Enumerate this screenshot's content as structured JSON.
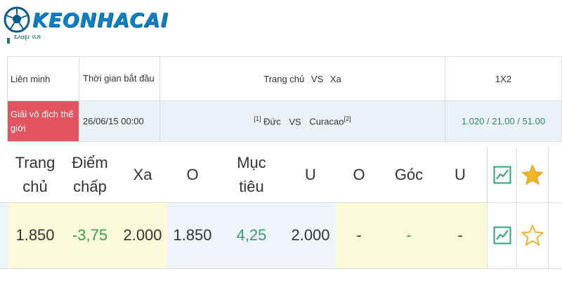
{
  "logo": {
    "text": "KEONHACAI"
  },
  "breadcrumb": {
    "text": "Đặp tối"
  },
  "match_table": {
    "headers": {
      "league": "Liên minh",
      "start_time": "Thời gian bắt đầu",
      "home": "Trang chủ",
      "vs": "VS",
      "away": "Xa",
      "market": "1X2"
    },
    "row": {
      "league": "Giải vô địch thế giới",
      "start_time": "26/06/15 00:00",
      "home_rank": "[1]",
      "home_team": "Đức",
      "vs": "VS",
      "away_team": "Curacao",
      "away_rank": "[2]",
      "odds_1x2": "1.020 / 21.00 / 51.00"
    }
  },
  "odds_panel": {
    "headers": {
      "home": "Trang chủ",
      "handicap": "Điểm chấp",
      "away": "Xa",
      "over_goals": "O",
      "goals": "Mục tiêu",
      "under_goals": "U",
      "over_corners": "O",
      "corners": "Góc",
      "under_corners": "U"
    },
    "values": {
      "home": "1.850",
      "handicap": "-3,75",
      "away": "2.000",
      "over_goals": "1.850",
      "goals": "4,25",
      "under_goals": "2.000",
      "over_corners": "-",
      "corners": "-",
      "under_corners": "-"
    },
    "favorite_header_filled": true,
    "favorite_row_filled": false
  },
  "colors": {
    "league_bg": "#e2525f",
    "accent_green": "#2b8a6a",
    "star_gold": "#f0b429",
    "logo_blue": "#0a7fc4"
  }
}
